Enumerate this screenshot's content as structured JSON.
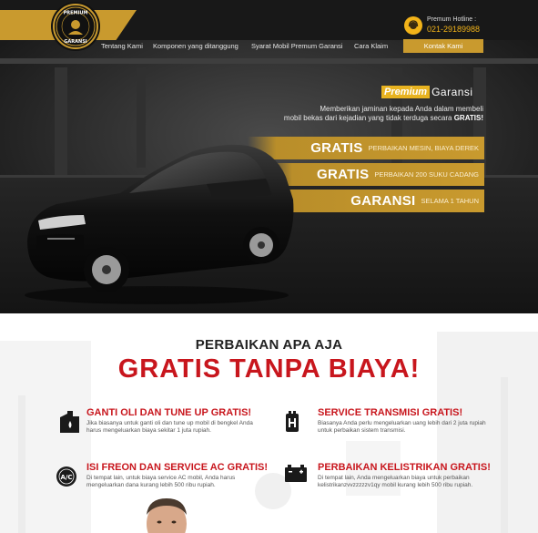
{
  "header": {
    "logo_text": "PREMIUM GARANSI",
    "hotline_label": "Premum Hotline :",
    "hotline_number": "021-29189988"
  },
  "nav": {
    "items": [
      {
        "label": "Tentang Kami"
      },
      {
        "label": "Komponen yang ditanggung"
      },
      {
        "label": "Syarat Mobil Premum Garansi"
      },
      {
        "label": "Cara Klaim"
      }
    ],
    "cta": "Kontak Kami"
  },
  "hero": {
    "brand_premium": "Premium",
    "brand_garansi": "Garansi",
    "tagline_line1": "Memberikan jaminan kepada Anda dalam membeli",
    "tagline_line2": "mobil bekas dari kejadian yang tidak terduga secara",
    "tagline_bold": "GRATIS!",
    "bars": [
      {
        "big": "GRATIS",
        "small": "PERBAIKAN MESIN, BIAYA DEREK"
      },
      {
        "big": "GRATIS",
        "small": "PERBAIKAN 200 SUKU CADANG"
      },
      {
        "big": "GARANSI",
        "small": "SELAMA 1 TAHUN"
      }
    ]
  },
  "section2": {
    "title1": "PERBAIKAN APA AJA",
    "title2": "GRATIS TANPA BIAYA!",
    "features": [
      {
        "icon": "oil-can-icon",
        "title": "GANTI OLI  DAN TUNE UP GRATIS!",
        "desc": "Jika biasanya untuk ganti oli dan tune up mobil di bengkel Anda harus mengeluarkan biaya sekitar 1 juta rupiah."
      },
      {
        "icon": "transmission-icon",
        "title": "SERVICE TRANSMISI GRATIS!",
        "desc": "Biasanya Anda perlu mengeluarkan uang lebih dari 2 juta rupiah untuk perbaikan sistem transmisi."
      },
      {
        "icon": "ac-freon-icon",
        "title": "ISI FREON DAN SERVICE AC GRATIS!",
        "desc": "Di tempat lain, untuk biaya service AC mobil, Anda harus mengeluarkan dana kurang lebih 500 ribu rupiah."
      },
      {
        "icon": "car-battery-icon",
        "title": "PERBAIKAN KELISTRIKAN GRATIS!",
        "desc": "Di tempat lain, Anda mengeluarkan biaya untuk perbaikan kelistrikanzvvzzzzzv1qy mobil kurang lebih 500 ribu rupiah."
      }
    ]
  },
  "colors": {
    "gold": "#c99a2e",
    "red": "#c8161d",
    "dark": "#181818"
  }
}
